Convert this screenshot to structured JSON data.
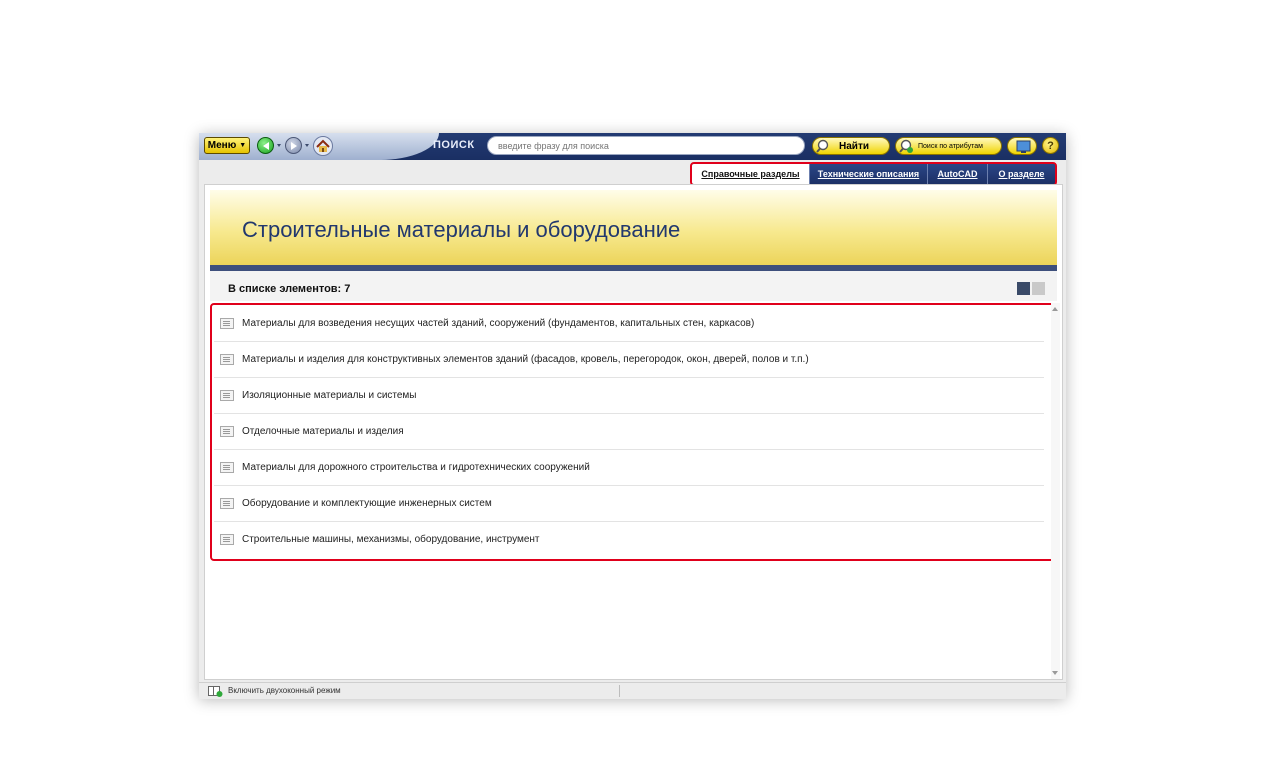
{
  "toolbar": {
    "menu_label": "Меню",
    "search_label": "ПОИСК",
    "search_placeholder": "введите фразу для поиска",
    "find_label": "Найти",
    "attr_search_label": "Поиск по атрибутам",
    "help_label": "?"
  },
  "tabs": [
    {
      "label": "Справочные разделы",
      "active": true
    },
    {
      "label": "Технические описания",
      "active": false
    },
    {
      "label": "AutoCAD",
      "active": false
    },
    {
      "label": "О разделе",
      "active": false
    }
  ],
  "banner": {
    "title": "Строительные материалы и оборудование"
  },
  "list": {
    "count_label": "В списке элементов: 7",
    "items": [
      "Материалы для возведения несущих частей зданий, сооружений (фундаментов, капитальных стен, каркасов)",
      "Материалы и изделия для конструктивных элементов зданий (фасадов, кровель, перегородок, окон, дверей, полов и т.п.)",
      "Изоляционные материалы и системы",
      "Отделочные материалы и изделия",
      "Материалы для дорожного строительства и гидротехнических сооружений",
      "Оборудование и комплектующие инженерных систем",
      "Строительные машины, механизмы, оборудование, инструмент"
    ]
  },
  "statusbar": {
    "dual_mode_label": "Включить двухоконный режим"
  },
  "colors": {
    "accent_red": "#e0001b",
    "toolbar_blue": "#1a2f63",
    "banner_yellow": "#f7e98f",
    "title_blue": "#22386e"
  }
}
